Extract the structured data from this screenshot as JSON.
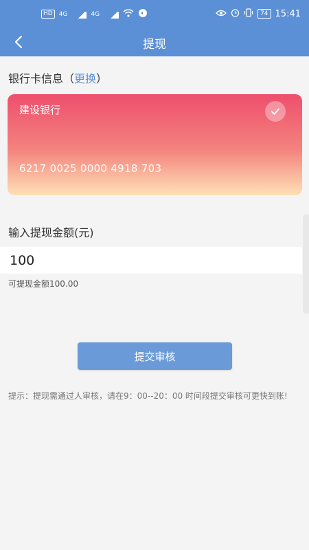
{
  "status_bar": {
    "hd_badge": "HD",
    "network_1": "4G",
    "network_2": "4G",
    "battery": "74",
    "time": "15:41"
  },
  "nav": {
    "title": "提现"
  },
  "bank_section": {
    "label": "银行卡信息（",
    "change_link": "更换",
    "label_close": "）"
  },
  "card": {
    "bank_name": "建设银行",
    "card_number": "6217 0025 0000 4918 703"
  },
  "amount_section": {
    "label": "输入提现金额(元)",
    "input_value": "100",
    "available_text": "可提现金额100.00"
  },
  "submit": {
    "label": "提交审核"
  },
  "tip": {
    "text": "提示：提现需通过人审核，请在9：00--20：00 时间段提交审核可更快到账!"
  },
  "colors": {
    "accent": "#5b8fd6",
    "button": "#6b9ad9",
    "card_top": "#ee4f6d",
    "card_bottom": "#fde0b6"
  }
}
